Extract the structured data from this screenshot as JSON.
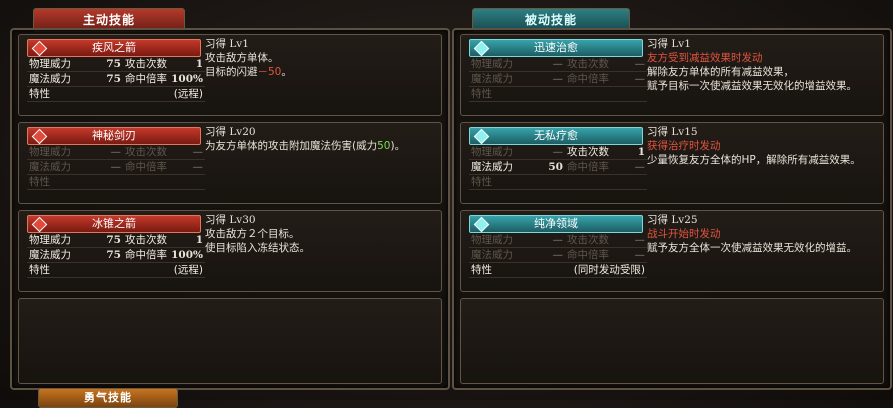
{
  "tabs": {
    "active": "主动技能",
    "passive": "被动技能",
    "bottom": "勇气技能"
  },
  "active_skills": [
    {
      "name": "疾风之箭",
      "level": "习得 Lv1",
      "physical_power_label": "物理威力",
      "physical_power": "75",
      "hits_label": "攻击次数",
      "hits": "1",
      "magic_power_label": "魔法威力",
      "magic_power": "75",
      "accuracy_label": "命中倍率",
      "accuracy": "100%",
      "trait_label": "特性",
      "trait": "(远程)",
      "desc_line1": "攻击敌方单体。",
      "desc_line2_prefix": "目标的闪避",
      "desc_line2_value": "－50",
      "desc_line2_suffix": "。"
    },
    {
      "name": "神秘剑刃",
      "level": "习得 Lv20",
      "physical_power_label": "物理威力",
      "physical_power": "—",
      "hits_label": "攻击次数",
      "hits": "—",
      "magic_power_label": "魔法威力",
      "magic_power": "—",
      "accuracy_label": "命中倍率",
      "accuracy": "—",
      "trait_label": "特性",
      "trait": "",
      "desc_prefix": "为友方单体的攻击附加魔法伤害(威力",
      "desc_value": "50",
      "desc_suffix": ")。"
    },
    {
      "name": "冰锥之箭",
      "level": "习得 Lv30",
      "physical_power_label": "物理威力",
      "physical_power": "75",
      "hits_label": "攻击次数",
      "hits": "1",
      "magic_power_label": "魔法威力",
      "magic_power": "75",
      "accuracy_label": "命中倍率",
      "accuracy": "100%",
      "trait_label": "特性",
      "trait": "(远程)",
      "desc_line1": "攻击敌方２个目标。",
      "desc_line2": "使目标陷入冻结状态。"
    }
  ],
  "passive_skills": [
    {
      "name": "迅速治愈",
      "level": "习得 Lv1",
      "physical_power_label": "物理威力",
      "physical_power": "—",
      "hits_label": "攻击次数",
      "hits": "—",
      "magic_power_label": "魔法威力",
      "magic_power": "—",
      "accuracy_label": "命中倍率",
      "accuracy": "—",
      "trait_label": "特性",
      "trait": "",
      "trigger": "友方受到减益效果时发动",
      "desc_line1": "解除友方单体的所有减益效果，",
      "desc_line2": "赋予目标一次使减益效果无效化的增益效果。"
    },
    {
      "name": "无私疗愈",
      "level": "习得 Lv15",
      "physical_power_label": "物理威力",
      "physical_power": "—",
      "hits_label": "攻击次数",
      "hits": "1",
      "magic_power_label": "魔法威力",
      "magic_power": "50",
      "accuracy_label": "命中倍率",
      "accuracy": "—",
      "trait_label": "特性",
      "trait": "",
      "trigger": "获得治疗时发动",
      "desc_line1": "少量恢复友方全体的HP，解除所有减益效果。"
    },
    {
      "name": "纯净领域",
      "level": "习得 Lv25",
      "physical_power_label": "物理威力",
      "physical_power": "—",
      "hits_label": "攻击次数",
      "hits": "—",
      "magic_power_label": "魔法威力",
      "magic_power": "—",
      "accuracy_label": "命中倍率",
      "accuracy": "—",
      "trait_label": "特性",
      "trait": "(同时发动受限)",
      "trigger": "战斗开始时发动",
      "desc_line1": "赋予友方全体一次使减益效果无效化的增益。"
    }
  ],
  "colors": {
    "active_tab": "#b33a2c",
    "passive_tab": "#2e7f85",
    "trigger_text": "#e0543f",
    "value_highlight": "#7ed957"
  }
}
